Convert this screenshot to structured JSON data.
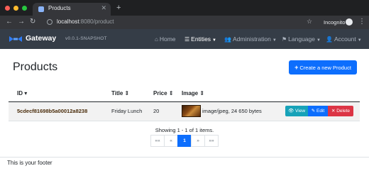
{
  "browser": {
    "tab_title": "Products",
    "tab_close": "✕",
    "new_tab": "+",
    "url_host": "localhost",
    "url_rest": ":8080/product",
    "incognito_label": "Incognito"
  },
  "navbar": {
    "brand": "Gateway",
    "version": "v0.0.1-SNAPSHOT",
    "items": [
      {
        "label": "Home",
        "icon": "home-icon"
      },
      {
        "label": "Entities",
        "icon": "list-icon",
        "active": true
      },
      {
        "label": "Administration",
        "icon": "users-cog-icon"
      },
      {
        "label": "Language",
        "icon": "flag-icon"
      },
      {
        "label": "Account",
        "icon": "user-icon"
      }
    ]
  },
  "page": {
    "title": "Products",
    "create_label": "Create a new Product"
  },
  "table": {
    "headers": [
      "ID",
      "Title",
      "Price",
      "Image"
    ],
    "rows": [
      {
        "id": "5cdecf81698b5a00012a8238",
        "title": "Friday Lunch",
        "price": "20",
        "image": "image/jpeg, 24 650 bytes"
      }
    ],
    "actions": {
      "view": "View",
      "edit": "Edit",
      "delete": "Delete"
    }
  },
  "pagination": {
    "info": "Showing 1 - 1 of 1 items.",
    "first": "««",
    "prev": "«",
    "current": "1",
    "next": "»",
    "last": "»»"
  },
  "footer": {
    "text": "This is your footer"
  },
  "colors": {
    "navbar": "#353d47",
    "primary": "#0d6efd",
    "info": "#17a2b8",
    "danger": "#dc3545"
  }
}
